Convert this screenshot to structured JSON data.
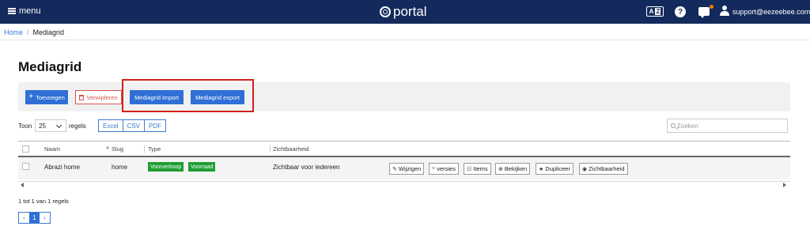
{
  "topbar": {
    "menu_label": "menu",
    "brand": "portal",
    "translate_icon_text": "A",
    "translate_icon_text2": "Z",
    "help_icon_text": "?",
    "user_email": "support@eezeebee.com",
    "colors": {
      "bar": "#142a5c",
      "notification": "#f07d00"
    }
  },
  "breadcrumb": {
    "home": "Home",
    "separator": "/",
    "current": "Mediagrid"
  },
  "page": {
    "title": "Mediagrid"
  },
  "toolbar": {
    "add_label": "Toevoegen",
    "add_icon": "plus-icon",
    "delete_label": "Verwijderen",
    "delete_icon": "trash-icon",
    "import_label": "Mediagrid import",
    "export_label": "Mediagrid export",
    "highlight_color": "#d0201b"
  },
  "length": {
    "label_before": "Toon",
    "value": "25",
    "label_after": "regels"
  },
  "export_buttons": [
    "Excel",
    "CSV",
    "PDF"
  ],
  "search": {
    "placeholder": "Zoeken",
    "value": ""
  },
  "table": {
    "columns": [
      "Naam",
      "Slug",
      "Type",
      "Zichtbaarheid"
    ],
    "rows": [
      {
        "naam": "Abrazi home",
        "slug": "home",
        "types": [
          "Voorverkoop",
          "Voorraad"
        ],
        "zichtbaarheid": "Zichtbaar voor iedereen",
        "actions": [
          {
            "label": "Wijzigen",
            "icon": "edit-icon"
          },
          {
            "label": "versies",
            "icon": "branch-icon"
          },
          {
            "label": "Items",
            "icon": "sitemap-icon"
          },
          {
            "label": "Bekijken",
            "icon": "globe-icon"
          },
          {
            "label": "Dupliceer",
            "icon": "star-icon"
          },
          {
            "label": "Zichtbaarheid",
            "icon": "eye-icon"
          }
        ]
      }
    ]
  },
  "info": "1 tot 1 van 1 regels",
  "pagination": {
    "prev": "‹",
    "current": "1",
    "next": "›"
  }
}
